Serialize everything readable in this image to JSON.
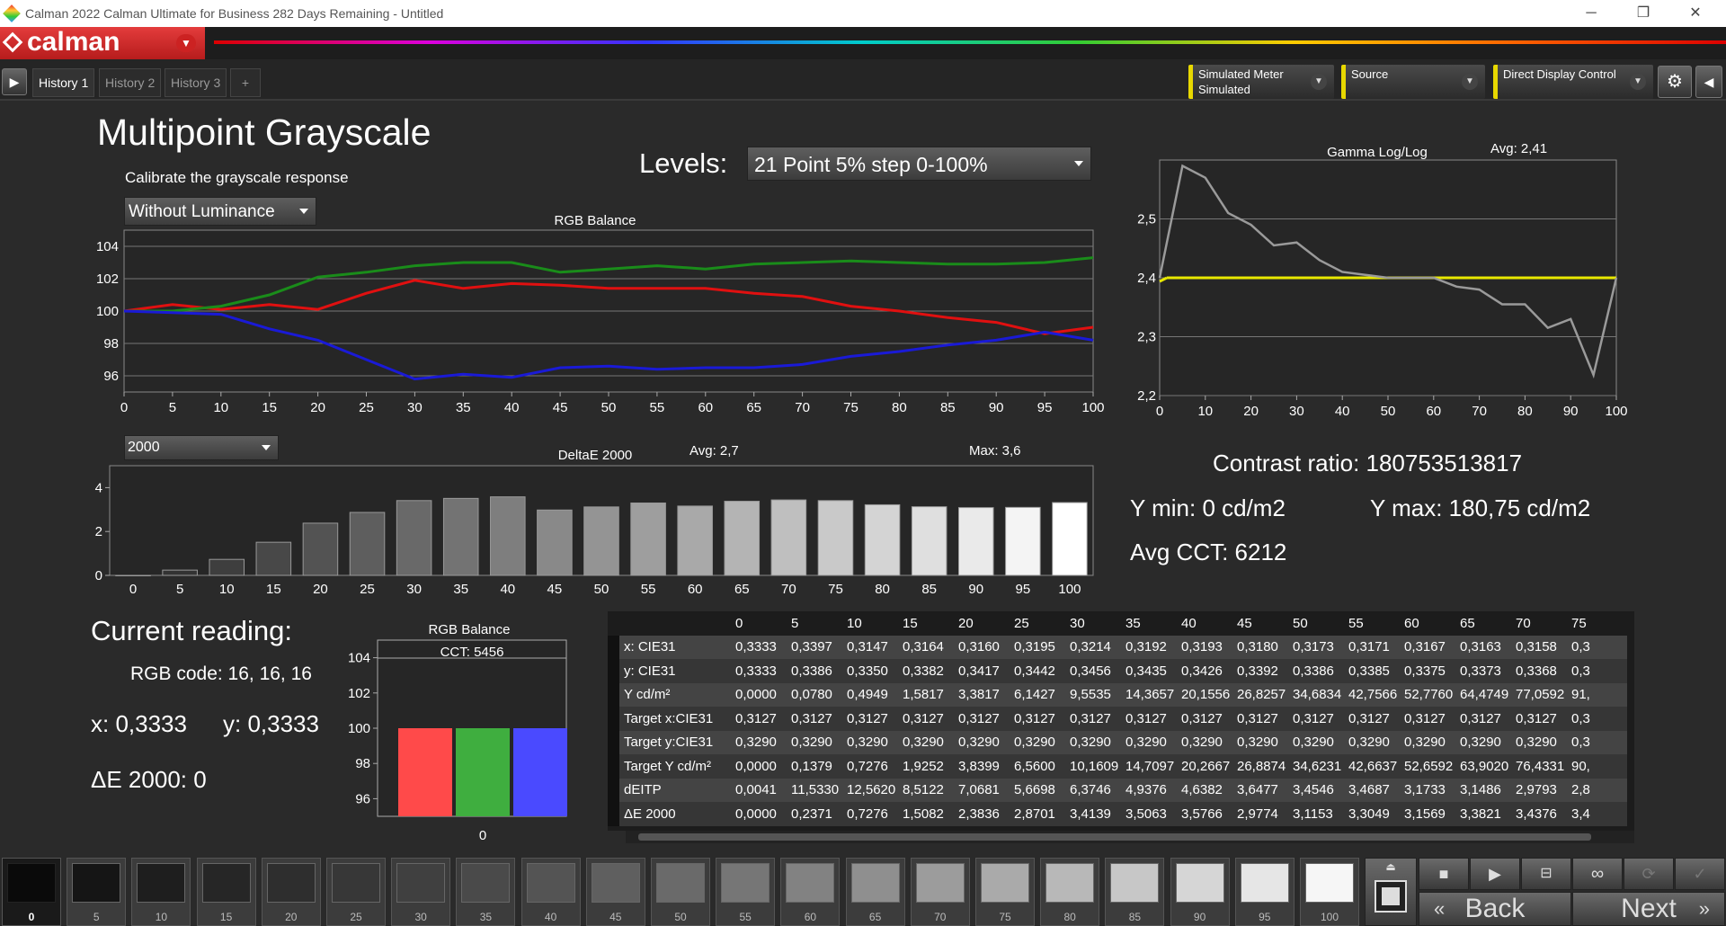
{
  "window": {
    "title": "Calman 2022 Calman Ultimate for Business 282 Days Remaining  - Untitled",
    "minimize": "─",
    "restore": "❐",
    "close": "✕"
  },
  "brand": {
    "name": "calman"
  },
  "tabs": [
    {
      "label": "History 1"
    },
    {
      "label": "History 2"
    },
    {
      "label": "History 3"
    },
    {
      "label": "+"
    }
  ],
  "devices": {
    "meter": {
      "line1": "Simulated Meter",
      "line2": "Simulated"
    },
    "source": {
      "line1": "Source",
      "line2": ""
    },
    "display": {
      "line1": "Direct Display Control",
      "line2": ""
    }
  },
  "page": {
    "title": "Multipoint Grayscale",
    "subtitle": "Calibrate the grayscale response",
    "levels_label": "Levels:",
    "levels_value": "21 Point 5% step 0-100%",
    "luminance_mode": "Without Luminance",
    "de_mode": "2000"
  },
  "rgb_chart": {
    "type": "line",
    "title": "RGB Balance",
    "x": [
      0,
      5,
      10,
      15,
      20,
      25,
      30,
      35,
      40,
      45,
      50,
      55,
      60,
      65,
      70,
      75,
      80,
      85,
      90,
      95,
      100
    ],
    "ylim": [
      95,
      105
    ],
    "yticks": [
      96,
      98,
      100,
      102,
      104
    ],
    "series": [
      {
        "color": "#e01010",
        "values": [
          100.0,
          100.4,
          100.1,
          100.4,
          100.1,
          101.1,
          101.9,
          101.4,
          101.7,
          101.6,
          101.4,
          101.4,
          101.4,
          101.1,
          100.9,
          100.3,
          100.0,
          99.6,
          99.3,
          98.6,
          99.0
        ]
      },
      {
        "color": "#1a8c1a",
        "values": [
          100.0,
          100.0,
          100.3,
          101.0,
          102.1,
          102.4,
          102.8,
          103.0,
          103.0,
          102.4,
          102.6,
          102.8,
          102.6,
          102.9,
          103.0,
          103.1,
          103.0,
          102.9,
          102.9,
          103.0,
          103.3
        ]
      },
      {
        "color": "#1a1ad6",
        "values": [
          100.0,
          99.9,
          99.8,
          98.9,
          98.2,
          97.0,
          95.8,
          96.1,
          95.9,
          96.5,
          96.6,
          96.4,
          96.5,
          96.5,
          96.7,
          97.2,
          97.5,
          97.9,
          98.2,
          98.7,
          98.2
        ]
      }
    ]
  },
  "de_chart": {
    "type": "bar",
    "title": "DeltaE 2000",
    "avg": "Avg: 2,7",
    "max": "Max: 3,6",
    "categories": [
      "0",
      "5",
      "10",
      "15",
      "20",
      "25",
      "30",
      "35",
      "40",
      "45",
      "50",
      "55",
      "60",
      "65",
      "70",
      "75",
      "80",
      "85",
      "90",
      "95",
      "100"
    ],
    "values": [
      0.0,
      0.24,
      0.73,
      1.51,
      2.38,
      2.87,
      3.41,
      3.51,
      3.58,
      2.98,
      3.12,
      3.3,
      3.16,
      3.38,
      3.44,
      3.41,
      3.22,
      3.13,
      3.09,
      3.1,
      3.32
    ],
    "ylim": [
      0,
      5
    ],
    "yticks": [
      0,
      2,
      4
    ]
  },
  "gamma_chart": {
    "type": "line",
    "title": "Gamma Log/Log",
    "avg": "Avg: 2,41",
    "x": [
      0,
      5,
      10,
      15,
      20,
      25,
      30,
      35,
      40,
      45,
      50,
      55,
      60,
      65,
      70,
      75,
      80,
      85,
      90,
      95,
      100
    ],
    "values": [
      2.4,
      2.59,
      2.57,
      2.51,
      2.49,
      2.455,
      2.46,
      2.43,
      2.41,
      2.405,
      2.4,
      2.4,
      2.4,
      2.385,
      2.38,
      2.355,
      2.355,
      2.315,
      2.33,
      2.235,
      2.4
    ],
    "target": 2.4,
    "ylim": [
      2.2,
      2.6
    ],
    "yticks": [
      "2,2",
      "2,3",
      "2,4",
      "2,5"
    ],
    "xticks": [
      0,
      10,
      20,
      30,
      40,
      50,
      60,
      70,
      80,
      90,
      100
    ],
    "colors": {
      "measured": "#9a9a9a",
      "target": "#e8e800"
    }
  },
  "stats": {
    "contrast": "Contrast ratio: 180753513817",
    "ymin": "Y min: 0 cd/m2",
    "ymax": "Y max: 180,75 cd/m2",
    "avg_cct": "Avg CCT: 6212"
  },
  "current": {
    "heading": "Current reading:",
    "rgb_code": "RGB code: 16, 16, 16",
    "x": "x: 0,3333",
    "y": "y: 0,3333",
    "de": "ΔE 2000: 0"
  },
  "current_chart": {
    "type": "bar",
    "title": "RGB Balance",
    "cct": "CCT: 5456",
    "categories": [
      "R",
      "G",
      "B"
    ],
    "values": [
      100,
      100,
      100
    ],
    "xlabel": "0",
    "yticks": [
      96,
      98,
      100,
      102,
      104
    ],
    "ylim": [
      95,
      105
    ],
    "colors": [
      "#ff4a4a",
      "#3fae3f",
      "#4a4aff"
    ]
  },
  "table": {
    "columns": [
      "0",
      "5",
      "10",
      "15",
      "20",
      "25",
      "30",
      "35",
      "40",
      "45",
      "50",
      "55",
      "60",
      "65",
      "70",
      "75"
    ],
    "rows": [
      {
        "label": "x: CIE31",
        "values": [
          "0,3333",
          "0,3397",
          "0,3147",
          "0,3164",
          "0,3160",
          "0,3195",
          "0,3214",
          "0,3192",
          "0,3193",
          "0,3180",
          "0,3173",
          "0,3171",
          "0,3167",
          "0,3163",
          "0,3158",
          "0,3"
        ]
      },
      {
        "label": "y: CIE31",
        "values": [
          "0,3333",
          "0,3386",
          "0,3350",
          "0,3382",
          "0,3417",
          "0,3442",
          "0,3456",
          "0,3435",
          "0,3426",
          "0,3392",
          "0,3386",
          "0,3385",
          "0,3375",
          "0,3373",
          "0,3368",
          "0,3"
        ]
      },
      {
        "label": "Y cd/m²",
        "values": [
          "0,0000",
          "0,0780",
          "0,4949",
          "1,5817",
          "3,3817",
          "6,1427",
          "9,5535",
          "14,3657",
          "20,1556",
          "26,8257",
          "34,6834",
          "42,7566",
          "52,7760",
          "64,4749",
          "77,0592",
          "91,"
        ]
      },
      {
        "label": "Target x:CIE31",
        "values": [
          "0,3127",
          "0,3127",
          "0,3127",
          "0,3127",
          "0,3127",
          "0,3127",
          "0,3127",
          "0,3127",
          "0,3127",
          "0,3127",
          "0,3127",
          "0,3127",
          "0,3127",
          "0,3127",
          "0,3127",
          "0,3"
        ]
      },
      {
        "label": "Target y:CIE31",
        "values": [
          "0,3290",
          "0,3290",
          "0,3290",
          "0,3290",
          "0,3290",
          "0,3290",
          "0,3290",
          "0,3290",
          "0,3290",
          "0,3290",
          "0,3290",
          "0,3290",
          "0,3290",
          "0,3290",
          "0,3290",
          "0,3"
        ]
      },
      {
        "label": "Target Y cd/m²",
        "values": [
          "0,0000",
          "0,1379",
          "0,7276",
          "1,9252",
          "3,8399",
          "6,5600",
          "10,1609",
          "14,7097",
          "20,2667",
          "26,8874",
          "34,6231",
          "42,6637",
          "52,6592",
          "63,9020",
          "76,4331",
          "90,"
        ]
      },
      {
        "label": "dEITP",
        "values": [
          "0,0041",
          "11,5330",
          "12,5620",
          "8,5122",
          "7,0681",
          "5,6698",
          "6,3746",
          "4,9376",
          "4,6382",
          "3,6477",
          "3,4546",
          "3,4687",
          "3,1733",
          "3,1486",
          "2,9793",
          "2,8"
        ]
      },
      {
        "label": "ΔE 2000",
        "values": [
          "0,0000",
          "0,2371",
          "0,7276",
          "1,5082",
          "2,3836",
          "2,8701",
          "3,4139",
          "3,5063",
          "3,5766",
          "2,9774",
          "3,1153",
          "3,3049",
          "3,1569",
          "3,3821",
          "3,4376",
          "3,4"
        ]
      }
    ]
  },
  "swatches": [
    {
      "label": "0",
      "color": "#0a0a0a"
    },
    {
      "label": "5",
      "color": "#151515"
    },
    {
      "label": "10",
      "color": "#1e1e1e"
    },
    {
      "label": "15",
      "color": "#262626"
    },
    {
      "label": "20",
      "color": "#2e2e2e"
    },
    {
      "label": "25",
      "color": "#373737"
    },
    {
      "label": "30",
      "color": "#404040"
    },
    {
      "label": "35",
      "color": "#4a4a4a"
    },
    {
      "label": "40",
      "color": "#545454"
    },
    {
      "label": "45",
      "color": "#5f5f5f"
    },
    {
      "label": "50",
      "color": "#6a6a6a"
    },
    {
      "label": "55",
      "color": "#767676"
    },
    {
      "label": "60",
      "color": "#828282"
    },
    {
      "label": "65",
      "color": "#8f8f8f"
    },
    {
      "label": "70",
      "color": "#9c9c9c"
    },
    {
      "label": "75",
      "color": "#aaaaaa"
    },
    {
      "label": "80",
      "color": "#b8b8b8"
    },
    {
      "label": "85",
      "color": "#c7c7c7"
    },
    {
      "label": "90",
      "color": "#d6d6d6"
    },
    {
      "label": "95",
      "color": "#e6e6e6"
    },
    {
      "label": "100",
      "color": "#f6f6f6"
    }
  ],
  "nav": {
    "back": "Back",
    "next": "Next"
  }
}
